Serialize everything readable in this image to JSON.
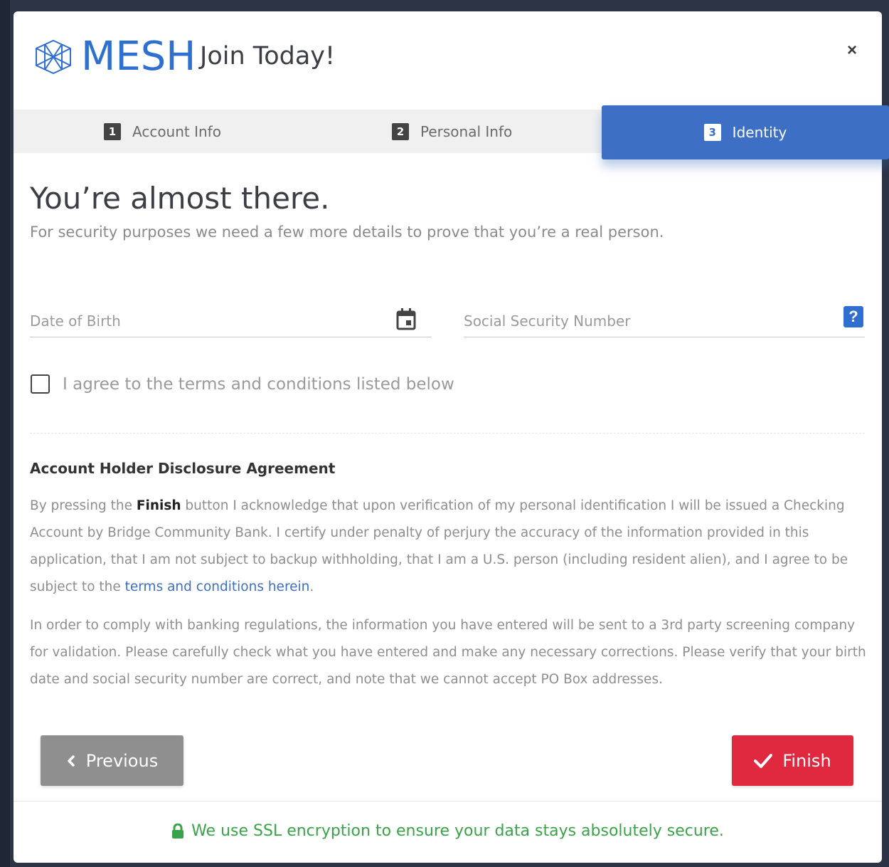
{
  "header": {
    "brand": "MESH",
    "subtitle": "Join Today!",
    "close_label": "×"
  },
  "tabs": [
    {
      "num": "1",
      "label": "Account Info",
      "active": false
    },
    {
      "num": "2",
      "label": "Personal Info",
      "active": false
    },
    {
      "num": "3",
      "label": "Identity",
      "active": true
    }
  ],
  "main": {
    "title": "You’re almost there.",
    "subtitle": "For security purposes we need a few more details to prove that you’re a real person.",
    "dob": {
      "placeholder": "Date of Birth",
      "value": ""
    },
    "ssn": {
      "placeholder": "Social Security Number",
      "value": "",
      "help": "?"
    },
    "agree_label": "I agree to the terms and conditions listed below",
    "agree_checked": false,
    "disclosure_title": "Account Holder Disclosure Agreement",
    "para1_a": "By pressing the ",
    "para1_bold": "Finish",
    "para1_b": " button I acknowledge that upon verification of my personal identification I will be issued a Checking Account by Bridge Community Bank. I certify under penalty of perjury the accuracy of the information provided in this application, that I am not subject to backup withholding, that I am a U.S. person (including resident alien), and I agree to be subject to the ",
    "para1_link": "terms and conditions herein",
    "para1_c": ".",
    "para2": "In order to comply with banking regulations, the information you have entered will be sent to a 3rd party screening company for validation. Please carefully check what you have entered and make any necessary corrections. Please verify that your birth date and social security number are correct, and note that we cannot accept PO Box addresses."
  },
  "buttons": {
    "previous": "Previous",
    "finish": "Finish"
  },
  "footer": {
    "ssl_text": "We use SSL encryption to ensure your data stays absolutely secure."
  },
  "colors": {
    "brand_blue": "#2f6fd0",
    "active_tab": "#3d6fc4",
    "finish_red": "#e0293f",
    "previous_gray": "#8f8f8f",
    "ssl_green": "#3aa34a"
  }
}
